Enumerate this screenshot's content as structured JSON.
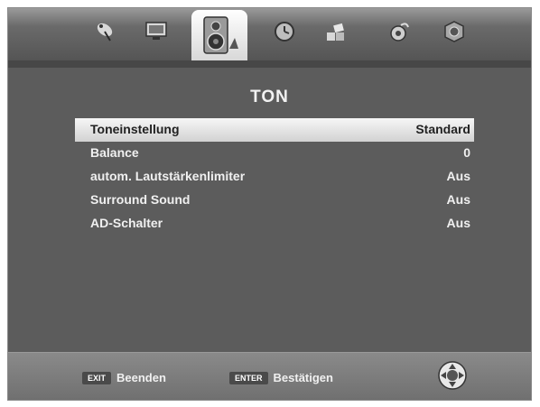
{
  "menu_tabs": [
    {
      "icon": "satellite-dish-icon"
    },
    {
      "icon": "monitor-icon"
    },
    {
      "icon": "speaker-icon",
      "active": true
    },
    {
      "icon": "clock-icon"
    },
    {
      "icon": "blocks-icon"
    },
    {
      "icon": "lock-icon"
    },
    {
      "icon": "settings-cube-icon"
    }
  ],
  "title": "TON",
  "items": [
    {
      "label": "Toneinstellung",
      "value": "Standard"
    },
    {
      "label": "Balance",
      "value": "0"
    },
    {
      "label": "autom. Lautstärkenlimiter",
      "value": "Aus"
    },
    {
      "label": "Surround Sound",
      "value": "Aus"
    },
    {
      "label": "AD-Schalter",
      "value": "Aus"
    }
  ],
  "footer": {
    "exit_key": "EXIT",
    "exit_label": "Beenden",
    "enter_key": "ENTER",
    "enter_label": "Bestätigen"
  }
}
